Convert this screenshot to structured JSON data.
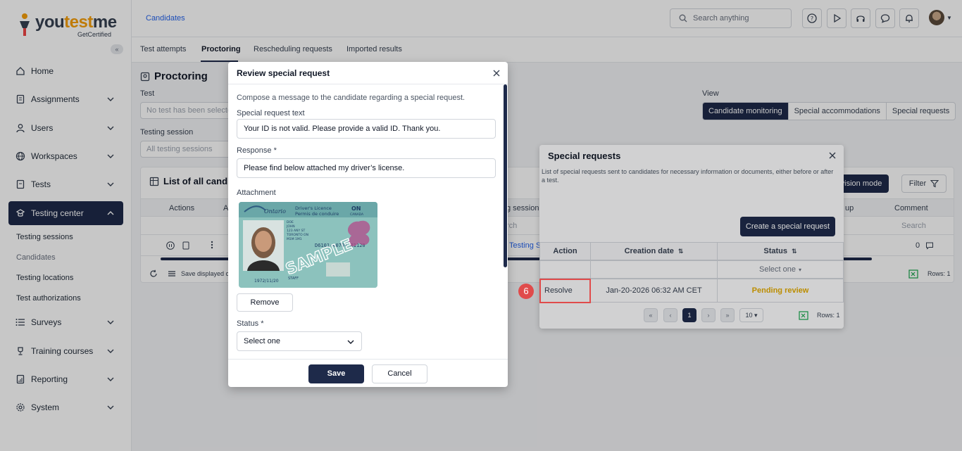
{
  "brand": {
    "name_pre": "you",
    "name_accent": "test",
    "name_post": "me",
    "tagline": "GetCertified"
  },
  "sidebar": {
    "items": [
      {
        "label": "Home",
        "icon": "home-icon"
      },
      {
        "label": "Assignments",
        "icon": "clipboard-icon"
      },
      {
        "label": "Users",
        "icon": "user-icon"
      },
      {
        "label": "Workspaces",
        "icon": "globe-icon"
      },
      {
        "label": "Tests",
        "icon": "document-icon"
      },
      {
        "label": "Testing center",
        "icon": "testing-center-icon"
      },
      {
        "label": "Surveys",
        "icon": "list-icon"
      },
      {
        "label": "Training courses",
        "icon": "trophy-icon"
      },
      {
        "label": "Reporting",
        "icon": "report-icon"
      },
      {
        "label": "System",
        "icon": "gear-icon"
      }
    ],
    "sub_items": [
      "Testing sessions",
      "Candidates",
      "Testing locations",
      "Test authorizations"
    ]
  },
  "header": {
    "breadcrumb": "Candidates",
    "search_placeholder": "Search anything"
  },
  "tabs": [
    "Test attempts",
    "Proctoring",
    "Rescheduling requests",
    "Imported results"
  ],
  "main": {
    "title": "Proctoring",
    "test_label": "Test",
    "test_placeholder": "No test has been selected",
    "session_label": "Testing session",
    "session_placeholder": "All testing sessions",
    "view_label": "View",
    "view_options": [
      "Candidate monitoring",
      "Special accommodations",
      "Special requests"
    ],
    "list_title": "List of all candidates",
    "supervision_btn": "rvision mode",
    "filter_btn": "Filter",
    "col_actions": "Actions",
    "col_a": "A",
    "col_session": "g session",
    "col_group": "up",
    "col_comment": "Comment",
    "search_placeholder": "Search",
    "search_placeholder_left": "rch",
    "row_session_link": "Testing S",
    "row_comment_count": "0",
    "footer_save": "Save displayed c",
    "rows_label": "Rows: 1"
  },
  "special_requests": {
    "title": "Special requests",
    "description": "List of special requests sent to candidates for necessary information or documents, either before or after a test.",
    "create_btn": "Create a special request",
    "columns": [
      "Action",
      "Creation date",
      "Status"
    ],
    "status_filter": "Select one",
    "rows": [
      {
        "action": "Resolve",
        "date": "Jan-20-2026 06:32 AM CET",
        "status": "Pending review"
      }
    ],
    "page": "1",
    "page_size": "10",
    "rows_label": "Rows: 1",
    "status_color": "#e0a800"
  },
  "annotation": {
    "step": "6"
  },
  "review": {
    "title": "Review special request",
    "intro": "Compose a message to the candidate regarding a special request.",
    "request_label": "Special request text",
    "request_value": "Your ID is not valid. Please provide a valid ID. Thank you.",
    "response_label": "Response *",
    "response_value": "Please find below attached my driver’s license.",
    "attachment_label": "Attachment",
    "license": {
      "province": "Ontario",
      "title1": "Driver's Licence",
      "title2": "Permis de conduire",
      "on": "ON",
      "canada": "CANADA",
      "number": "D6101-40707-21120",
      "dob": "1972/11/20",
      "sample": "SAMPLE"
    },
    "remove_btn": "Remove",
    "status_label": "Status *",
    "status_value": "Select one",
    "save_btn": "Save",
    "cancel_btn": "Cancel"
  },
  "colors": {
    "primary": "#1e2a4a",
    "accent": "#f59e0b",
    "link": "#2563eb",
    "highlight": "#e04b4b"
  }
}
